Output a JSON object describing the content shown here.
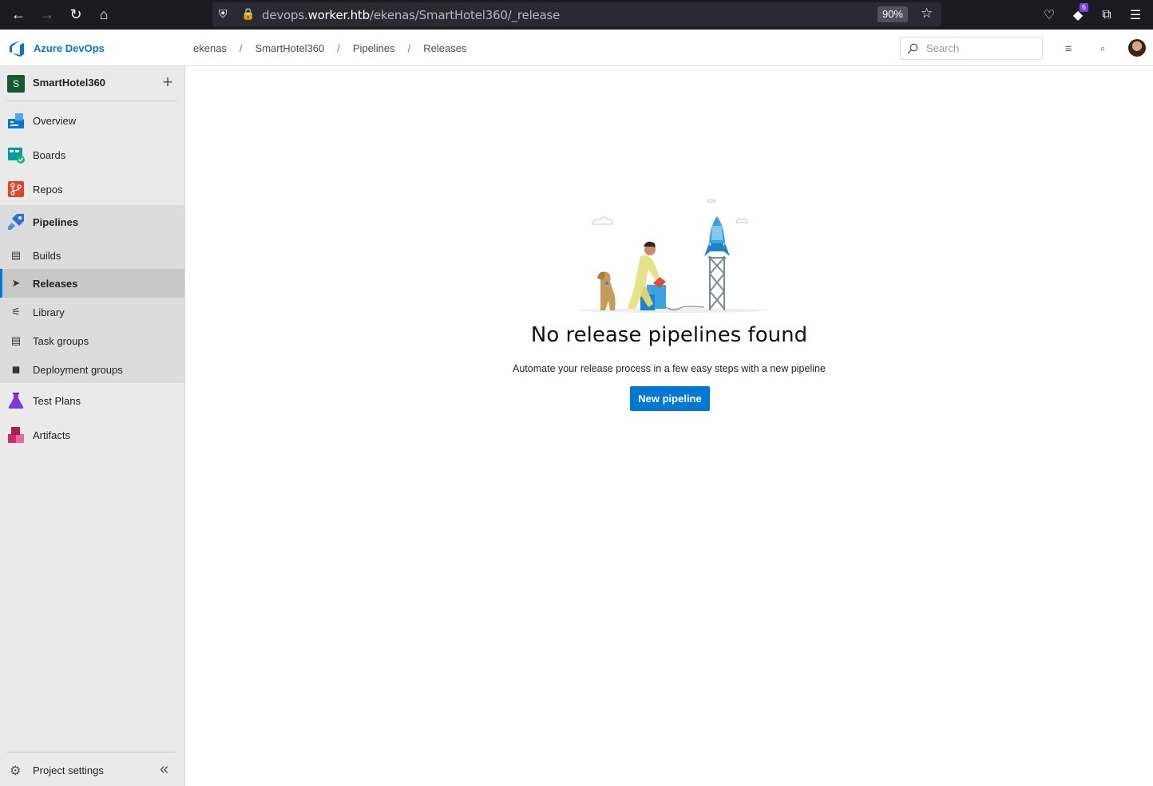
{
  "browser": {
    "url_prefix": "devops.",
    "url_domain": "worker.htb",
    "url_path": "/ekenas/SmartHotel360/_release",
    "zoom": "90%",
    "extension_badge": "6"
  },
  "header": {
    "brand": "Azure DevOps",
    "breadcrumb": [
      "ekenas",
      "SmartHotel360",
      "Pipelines",
      "Releases"
    ],
    "search_placeholder": "Search"
  },
  "sidebar": {
    "project_initial": "S",
    "project_name": "SmartHotel360",
    "items": [
      {
        "label": "Overview",
        "icon": "overview-icon",
        "color": "#0078d4"
      },
      {
        "label": "Boards",
        "icon": "boards-icon",
        "color": "#009ccc"
      },
      {
        "label": "Repos",
        "icon": "repos-icon",
        "color": "#e05a2b"
      },
      {
        "label": "Pipelines",
        "icon": "pipelines-icon",
        "color": "#2f6fd6"
      },
      {
        "label": "Test Plans",
        "icon": "test-plans-icon",
        "color": "#773adc"
      },
      {
        "label": "Artifacts",
        "icon": "artifacts-icon",
        "color": "#cc2d6d"
      }
    ],
    "pipeline_subitems": [
      {
        "label": "Builds",
        "icon": "builds-icon"
      },
      {
        "label": "Releases",
        "icon": "releases-icon",
        "active": true
      },
      {
        "label": "Library",
        "icon": "library-icon"
      },
      {
        "label": "Task groups",
        "icon": "task-groups-icon"
      },
      {
        "label": "Deployment groups",
        "icon": "deployment-groups-icon"
      }
    ],
    "settings_label": "Project settings"
  },
  "main": {
    "empty_title": "No release pipelines found",
    "empty_subtitle": "Automate your release process in a few easy steps with a new pipeline",
    "button_label": "New pipeline"
  },
  "colors": {
    "accent": "#0078d4"
  }
}
